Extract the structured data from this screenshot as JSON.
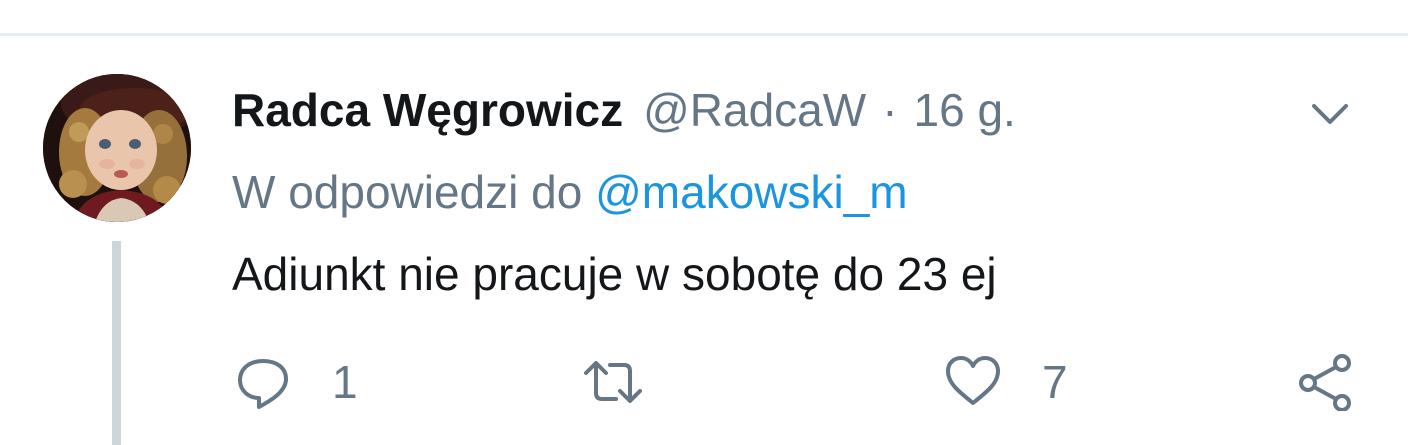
{
  "tweet": {
    "author_name": "Radca Węgrowicz",
    "author_handle": "@RadcaW",
    "separator": "·",
    "time": "16 g.",
    "reply_prefix": "W odpowiedzi do",
    "reply_mention": "@makowski_m",
    "text": "Adiunkt nie pracuje w sobotę do 23 ej",
    "avatar_icon": "doll-avatar-photo",
    "menu_icon": "chevron-down-icon"
  },
  "actions": {
    "reply": {
      "icon": "reply-icon",
      "count": "1"
    },
    "retweet": {
      "icon": "retweet-icon",
      "count": ""
    },
    "like": {
      "icon": "heart-icon",
      "count": "7"
    },
    "share": {
      "icon": "share-icon"
    }
  },
  "colors": {
    "text_primary": "#14171a",
    "text_secondary": "#657786",
    "link": "#1b95e0",
    "thread_line": "#ccd6dd",
    "divider": "#e6ecf0"
  }
}
